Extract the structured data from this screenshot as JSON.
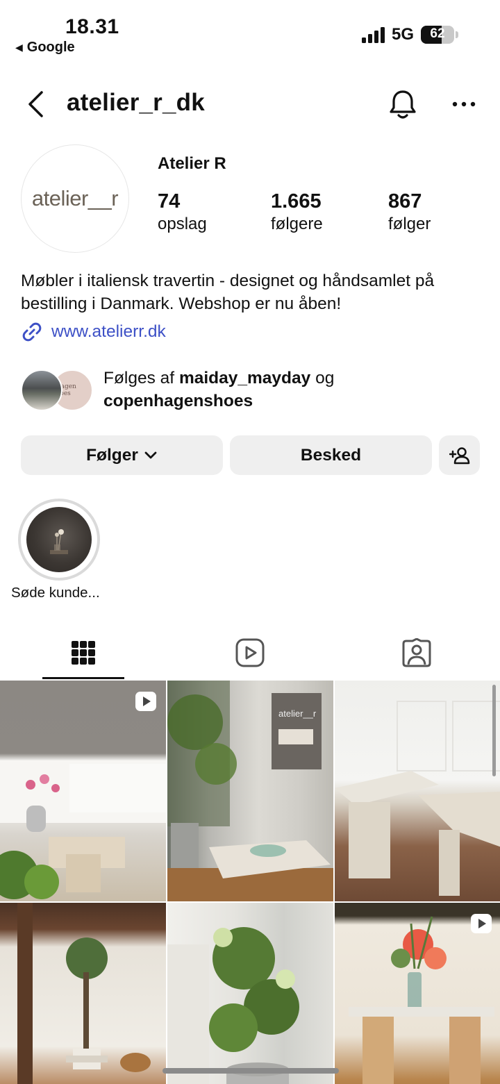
{
  "status_bar": {
    "time": "18.31",
    "back_app": "Google",
    "network": "5G",
    "battery": "62",
    "battery_level": 0.62
  },
  "header": {
    "username": "atelier_r_dk"
  },
  "profile": {
    "avatar_text": "atelier__r",
    "display_name": "Atelier R",
    "stats": {
      "posts_count": "74",
      "posts_label": "opslag",
      "followers_count": "1.665",
      "followers_label": "følgere",
      "following_count": "867",
      "following_label": "følger"
    },
    "bio_line1": "Møbler i italiensk travertin - designet og håndsamlet på",
    "bio_line2": "bestilling i Danmark. Webshop er nu åben!",
    "website": "www.atelierr.dk"
  },
  "followed_by": {
    "prefix": "Følges af",
    "user1": "maiday_mayday",
    "conjunction": "og",
    "user2": "copenhagenshoes",
    "avatar2_text": "nhagen shoes"
  },
  "actions": {
    "follow_label": "Følger",
    "message_label": "Besked"
  },
  "highlights": [
    {
      "label": "Søde kunde..."
    }
  ],
  "tabs": [
    "grid-icon",
    "reels-icon",
    "tagged-icon"
  ],
  "grid_posts": [
    {
      "id": "post-1",
      "is_reel": true
    },
    {
      "id": "post-2",
      "is_reel": false,
      "overlay_text": "atelier__r"
    },
    {
      "id": "post-3",
      "is_reel": false
    },
    {
      "id": "post-4",
      "is_reel": false
    },
    {
      "id": "post-5",
      "is_reel": false
    },
    {
      "id": "post-6",
      "is_reel": true
    }
  ],
  "colors": {
    "link": "#3d50c6",
    "button_bg": "#efefef",
    "text": "#111111"
  }
}
